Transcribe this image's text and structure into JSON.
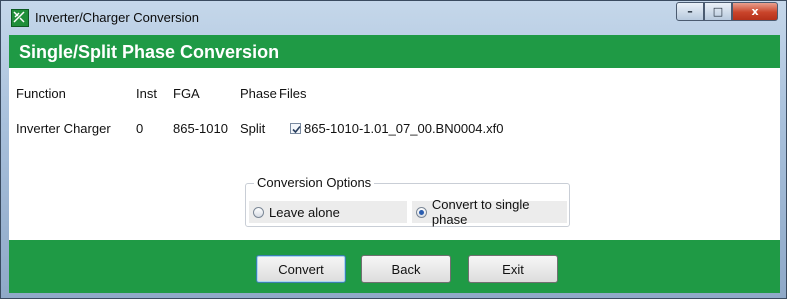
{
  "window": {
    "title": "Inverter/Charger Conversion"
  },
  "caption": {
    "minimize": "–",
    "maximize": "□",
    "close": "x"
  },
  "header": {
    "title": "Single/Split Phase Conversion"
  },
  "table": {
    "columns": [
      "Function",
      "Inst",
      "FGA",
      "Phase",
      "Files"
    ],
    "row": {
      "function": "Inverter Charger",
      "inst": "0",
      "fga": "865-1010",
      "phase": "Split",
      "file": "865-1010-1.01_07_00.BN0004.xf0",
      "file_checked": true
    }
  },
  "options": {
    "legend": "Conversion Options",
    "leave_alone": "Leave alone",
    "convert_single": "Convert to single phase",
    "selected": "convert_single"
  },
  "buttons": {
    "convert": "Convert",
    "back": "Back",
    "exit": "Exit"
  },
  "colors": {
    "accent_green": "#1f9a45"
  },
  "icons": {
    "app": "app-icon",
    "checkbox": "checkbox-checked-icon"
  }
}
